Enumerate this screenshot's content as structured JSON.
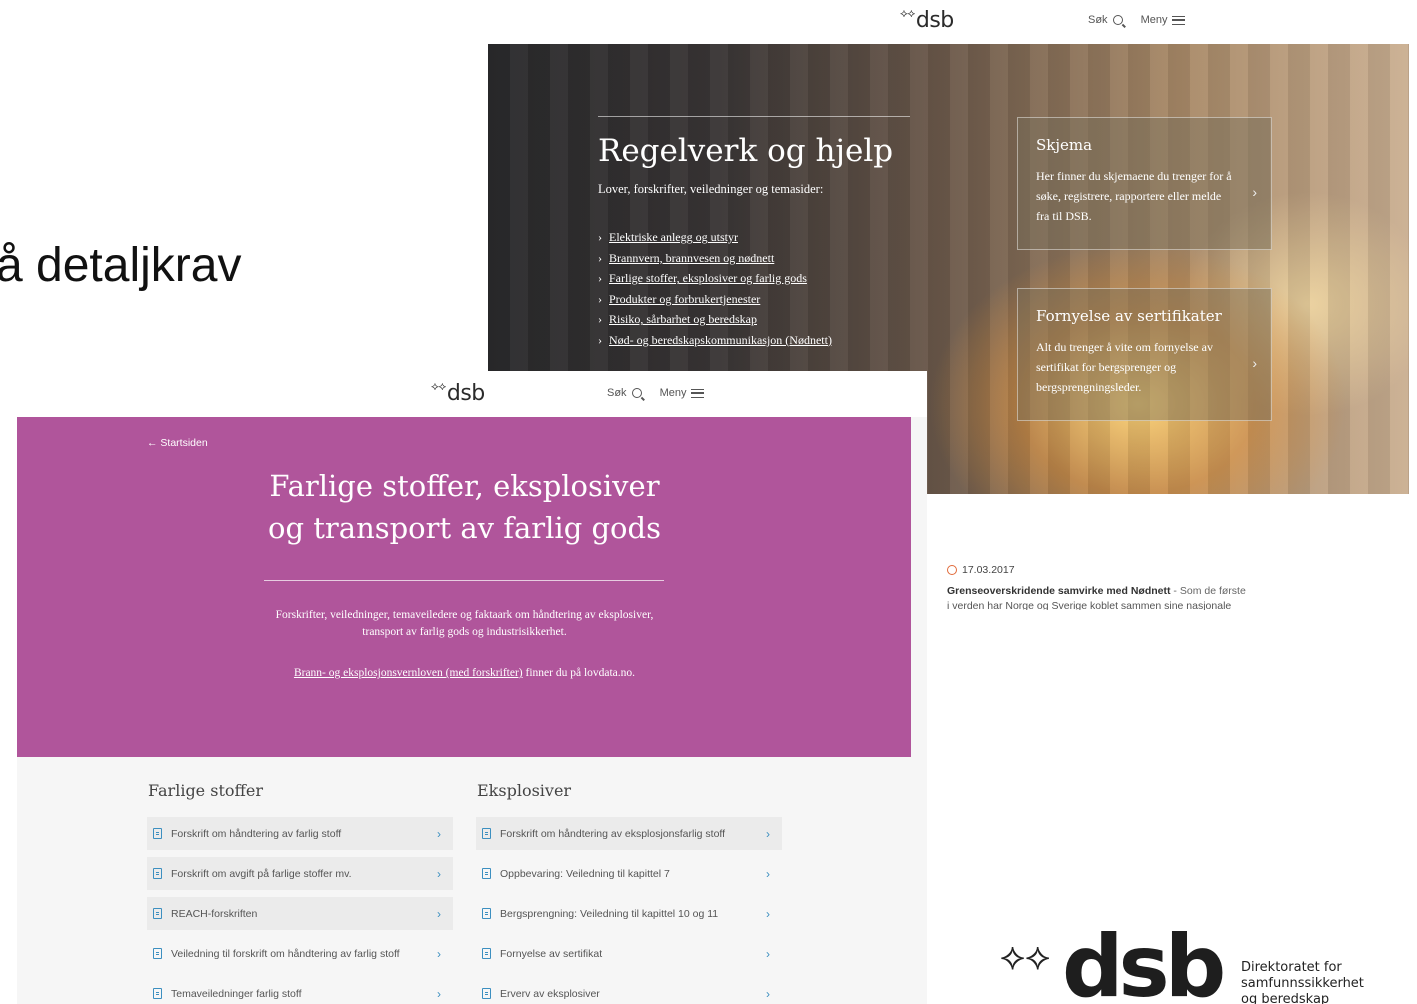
{
  "slide_text": "å detaljkrav",
  "back_page": {
    "logo": "dsb",
    "nav": {
      "search": "Søk",
      "menu": "Meny"
    },
    "hero": {
      "title": "Regelverk og hjelp",
      "subtitle": "Lover, forskrifter, veiledninger og temasider:",
      "links": [
        "Elektriske anlegg og utstyr",
        "Brannvern, brannvesen og nødnett",
        "Farlige stoffer, eksplosiver og farlig gods",
        "Produkter og forbrukertjenester",
        "Risiko, sårbarhet og beredskap",
        "Nød- og beredskapskommunikasjon (Nødnett)"
      ]
    },
    "cards": [
      {
        "title": "Skjema",
        "text": "Her finner du skjemaene du trenger for å søke, registrere, rapportere eller melde fra til DSB."
      },
      {
        "title": "Fornyelse av sertifikater",
        "text": "Alt du trenger å vite om fornyelse av sertifikat for bergsprenger og bergsprengningsleder."
      }
    ],
    "news": {
      "date": "17.03.2017",
      "headline": "Grenseoverskridende samvirke med Nødnett",
      "excerpt": " - Som de første",
      "excerpt2": "i verden har Norge og Sverige koblet sammen sine nasjonale"
    }
  },
  "front_page": {
    "logo": "dsb",
    "nav": {
      "search": "Søk",
      "menu": "Meny"
    },
    "back_link": "← Startsiden",
    "title_line1": "Farlige stoffer, eksplosiver",
    "title_line2": "og transport av farlig gods",
    "description": "Forskrifter, veiledninger, temaveiledere og faktaark om håndtering av eksplosiver, transport av farlig gods og industrisikkerhet.",
    "law_link": "Brann- og eksplosjonsvernloven (med forskrifter)",
    "law_suffix": " finner du på lovdata.no.",
    "col1": {
      "title": "Farlige stoffer",
      "items": [
        "Forskrift om håndtering av farlig stoff",
        "Forskrift om avgift på farlige stoffer mv.",
        "REACH-forskriften",
        "Veiledning til forskrift om håndtering av farlig stoff",
        "Temaveiledninger farlig stoff"
      ]
    },
    "col2": {
      "title": "Eksplosiver",
      "items": [
        "Forskrift om håndtering av eksplosjonsfarlig stoff",
        "Oppbevaring: Veiledning til kapittel 7",
        "Bergsprengning: Veiledning til kapittel 10 og 11",
        "Fornyelse av sertifikat",
        "Erverv av eksplosiver"
      ]
    }
  },
  "brand": {
    "wordmark": "dsb",
    "tagline_1": "Direktoratet for",
    "tagline_2": "samfunnssikkerhet",
    "tagline_3": "og beredskap"
  }
}
